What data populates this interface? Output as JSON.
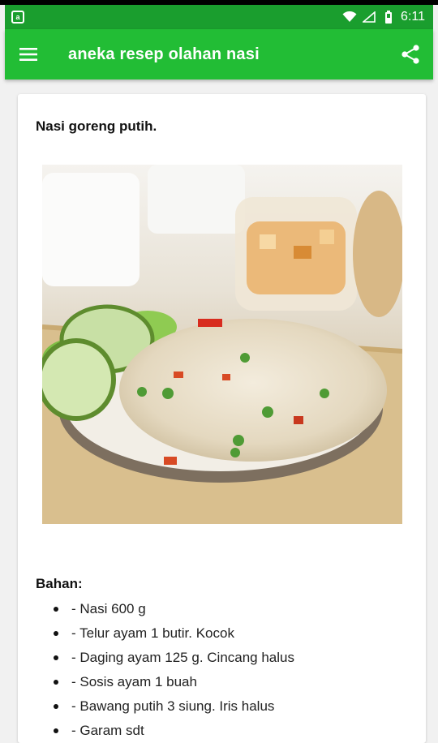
{
  "app": {
    "title": "aneka resep olahan nasi",
    "accent_color": "#22bd35",
    "status_bar_color": "#1a9e2e"
  },
  "status_bar": {
    "notification_icon": "app-notification-icon",
    "notification_glyph": "a",
    "time": "6:11",
    "icons": [
      "wifi-icon",
      "signal-icon",
      "battery-icon"
    ]
  },
  "toolbar": {
    "menu_icon": "hamburger-menu-icon",
    "share_icon": "share-icon"
  },
  "recipe": {
    "title": "Nasi goreng putih.",
    "image": "fried-rice-photo",
    "ingredients_label": "Bahan:",
    "ingredients": [
      "- Nasi 600 g",
      "- Telur ayam 1 butir. Kocok",
      "- Daging ayam 125 g. Cincang halus",
      "- Sosis ayam 1 buah",
      "- Bawang putih 3 siung. Iris halus",
      "- Garam sdt"
    ]
  }
}
